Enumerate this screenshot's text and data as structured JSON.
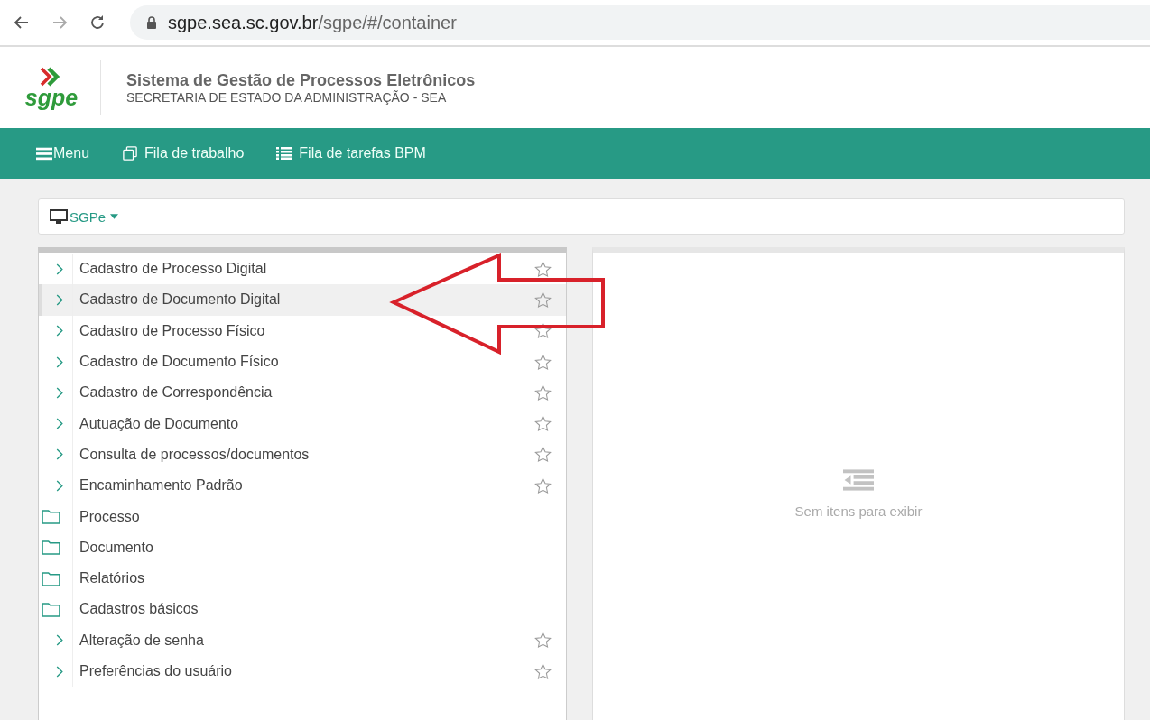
{
  "browser": {
    "url_host": "sgpe.sea.sc.gov.br",
    "url_path": "/sgpe/#/container"
  },
  "header": {
    "logo_text": "sgpe",
    "title": "Sistema de Gestão de Processos Eletrônicos",
    "subtitle": "SECRETARIA DE ESTADO DA ADMINISTRAÇÃO - SEA"
  },
  "nav": [
    {
      "label": "Menu",
      "kind": "menu"
    },
    {
      "label": "Fila de trabalho",
      "kind": "queue"
    },
    {
      "label": "Fila de tarefas BPM",
      "kind": "list"
    }
  ],
  "system_selector": {
    "label": "SGPe"
  },
  "menu_items": [
    {
      "label": "Cadastro de Processo Digital",
      "kind": "link",
      "selected": false
    },
    {
      "label": "Cadastro de Documento Digital",
      "kind": "link",
      "selected": true
    },
    {
      "label": "Cadastro de Processo Físico",
      "kind": "link",
      "selected": false
    },
    {
      "label": "Cadastro de Documento Físico",
      "kind": "link",
      "selected": false
    },
    {
      "label": "Cadastro de Correspondência",
      "kind": "link",
      "selected": false
    },
    {
      "label": "Autuação de Documento",
      "kind": "link",
      "selected": false
    },
    {
      "label": "Consulta de processos/documentos",
      "kind": "link",
      "selected": false
    },
    {
      "label": "Encaminhamento Padrão",
      "kind": "link",
      "selected": false
    },
    {
      "label": "Processo",
      "kind": "folder",
      "selected": false
    },
    {
      "label": "Documento",
      "kind": "folder",
      "selected": false
    },
    {
      "label": "Relatórios",
      "kind": "folder",
      "selected": false
    },
    {
      "label": "Cadastros básicos",
      "kind": "folder",
      "selected": false
    },
    {
      "label": "Alteração de senha",
      "kind": "link",
      "selected": false
    },
    {
      "label": "Preferências do usuário",
      "kind": "link",
      "selected": false
    }
  ],
  "empty_state": {
    "message": "Sem itens para exibir"
  }
}
